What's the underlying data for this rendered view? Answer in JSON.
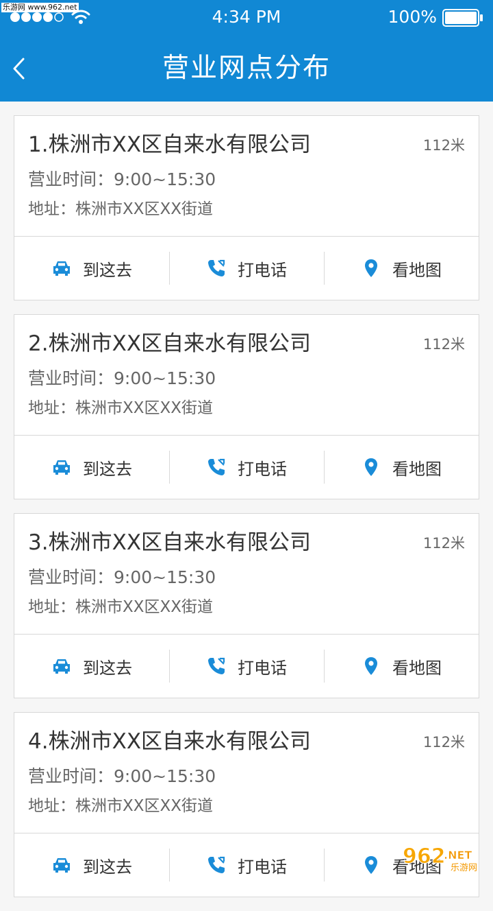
{
  "status_bar": {
    "watermark_text": "乐游网 www.962.net",
    "time": "4:34 PM",
    "battery": "100%"
  },
  "nav": {
    "title": "营业网点分布"
  },
  "actions": {
    "go_label": "到这去",
    "call_label": "打电话",
    "map_label": "看地图"
  },
  "branches": [
    {
      "title": "1.株洲市XX区自来水有限公司",
      "distance": "112米",
      "hours": "营业时间：9:00~15:30",
      "address": "地址：株洲市XX区XX街道"
    },
    {
      "title": "2.株洲市XX区自来水有限公司",
      "distance": "112米",
      "hours": "营业时间：9:00~15:30",
      "address": "地址：株洲市XX区XX街道"
    },
    {
      "title": "3.株洲市XX区自来水有限公司",
      "distance": "112米",
      "hours": "营业时间：9:00~15:30",
      "address": "地址：株洲市XX区XX街道"
    },
    {
      "title": "4.株洲市XX区自来水有限公司",
      "distance": "112米",
      "hours": "营业时间：9:00~15:30",
      "address": "地址：株洲市XX区XX街道"
    }
  ],
  "bottom_watermark": {
    "brand": "962",
    "suffix": ".NET",
    "sub": "乐游网"
  },
  "colors": {
    "header_bg": "#1188d4",
    "icon_blue": "#1a8cd8"
  }
}
